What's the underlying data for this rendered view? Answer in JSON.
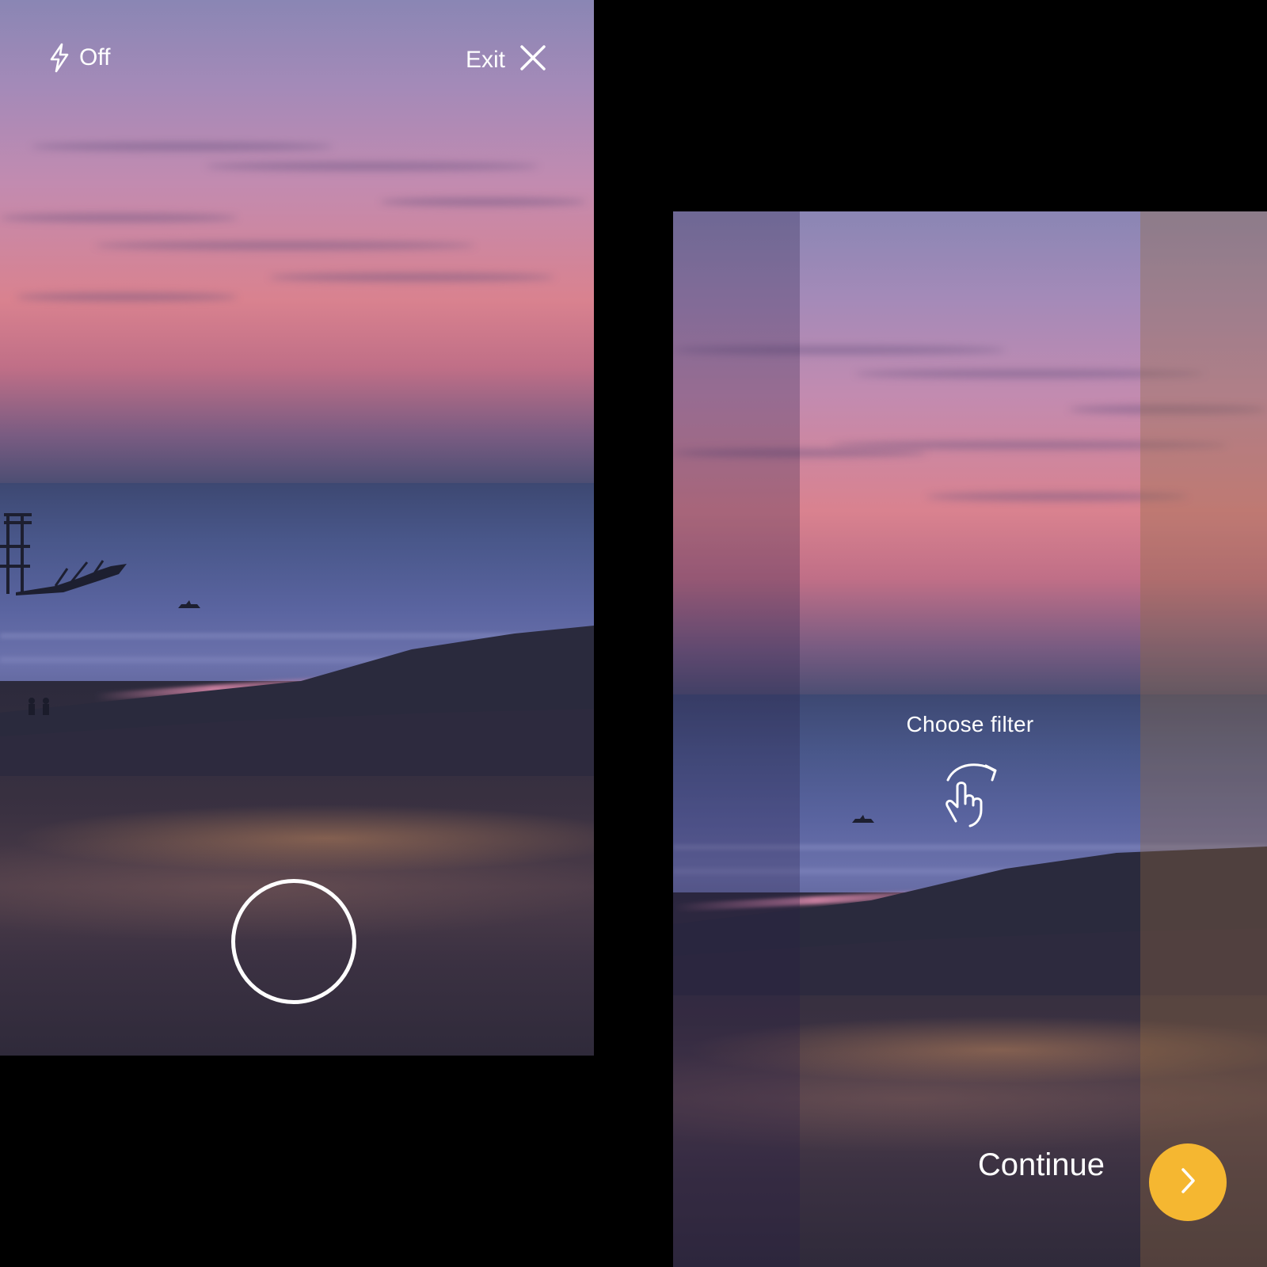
{
  "camera": {
    "flash_label": "Off",
    "exit_label": "Exit"
  },
  "filter": {
    "hint_label": "Choose filter",
    "continue_label": "Continue"
  },
  "colors": {
    "accent": "#f5b731",
    "icon": "#ffffff",
    "background": "#000000"
  },
  "icons": {
    "flash": "lightning-bolt-icon",
    "exit": "close-x-icon",
    "swipe": "swipe-hand-icon",
    "continue": "chevron-right-icon"
  }
}
